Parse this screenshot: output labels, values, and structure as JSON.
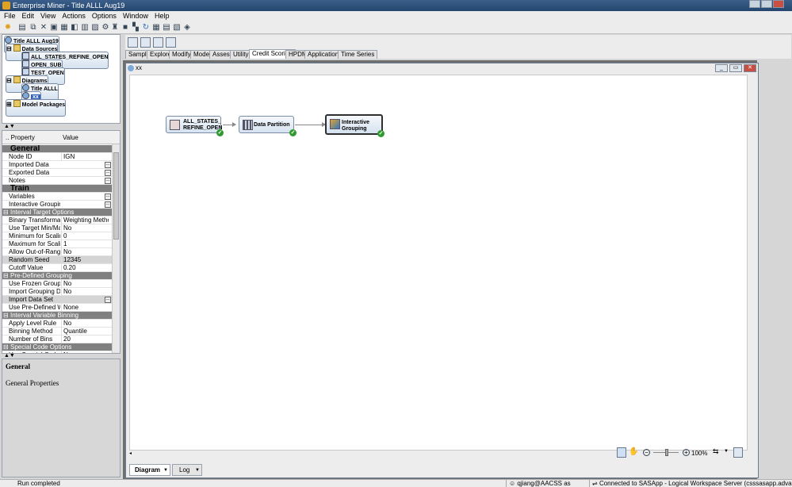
{
  "window": {
    "title": "Enterprise Miner - Title ALLL Aug19"
  },
  "menu": [
    "File",
    "Edit",
    "View",
    "Actions",
    "Options",
    "Window",
    "Help"
  ],
  "project_tree": {
    "root": "Title ALLL Aug19",
    "data_sources_label": "Data Sources",
    "data_sources": [
      "ALL_STATES_REFINE_OPEN",
      "OPEN_SUB",
      "TEST_OPEN"
    ],
    "diagrams_label": "Diagrams",
    "diagrams": [
      "Title ALLL",
      "xx"
    ],
    "model_packages_label": "Model Packages"
  },
  "properties": {
    "header_property": ".. Property",
    "header_value": "Value",
    "rows": [
      {
        "kind": "section",
        "label": "General"
      },
      {
        "kind": "row",
        "label": "Node ID",
        "value": "IGN"
      },
      {
        "kind": "row",
        "label": "Imported Data",
        "value": "",
        "ellipsis": true
      },
      {
        "kind": "row",
        "label": "Exported Data",
        "value": "",
        "ellipsis": true
      },
      {
        "kind": "row",
        "label": "Notes",
        "value": "",
        "ellipsis": true
      },
      {
        "kind": "section",
        "label": "Train"
      },
      {
        "kind": "row",
        "label": "Variables",
        "value": "",
        "ellipsis": true
      },
      {
        "kind": "row",
        "label": "Interactive Grouping",
        "value": "",
        "ellipsis": true
      },
      {
        "kind": "group",
        "label": "Interval Target Options"
      },
      {
        "kind": "row",
        "label": "Binary Transformation",
        "value": "Weighting Method"
      },
      {
        "kind": "row",
        "label": "Use Target Min/Max for Scaling",
        "value": "No"
      },
      {
        "kind": "row",
        "label": "Minimum for Scaling",
        "value": "0"
      },
      {
        "kind": "row",
        "label": "Maximum for Scaling",
        "value": "1"
      },
      {
        "kind": "row",
        "label": "Allow Out-of-Range Values",
        "value": "No"
      },
      {
        "kind": "row",
        "label": "Random Seed",
        "value": "12345",
        "gray": true
      },
      {
        "kind": "row",
        "label": "Cutoff Value",
        "value": "0.20"
      },
      {
        "kind": "group",
        "label": "Pre-Defined Grouping"
      },
      {
        "kind": "row",
        "label": "Use Frozen Groupings",
        "value": "No"
      },
      {
        "kind": "row",
        "label": "Import Grouping Data",
        "value": "No"
      },
      {
        "kind": "row",
        "label": "Import Data Set",
        "value": "",
        "ellipsis": true,
        "gray": true
      },
      {
        "kind": "row",
        "label": "Use Pre-Defined WOE",
        "value": "None"
      },
      {
        "kind": "group",
        "label": "Interval Variable Binning"
      },
      {
        "kind": "row",
        "label": "Apply Level Rule",
        "value": "No"
      },
      {
        "kind": "row",
        "label": "Binning Method",
        "value": "Quantile"
      },
      {
        "kind": "row",
        "label": "Number of Bins",
        "value": "20"
      },
      {
        "kind": "group",
        "label": "Special Code Options"
      },
      {
        "kind": "row",
        "label": "Use Special Codes",
        "value": "No"
      }
    ]
  },
  "description": {
    "title": "General",
    "text": "General Properties"
  },
  "node_tabs": [
    "Sample",
    "Explore",
    "Modify",
    "Model",
    "Assess",
    "Utility",
    "Credit Scoring",
    "HPDM",
    "Applications",
    "Time Series"
  ],
  "active_node_tab": "Credit Scoring",
  "diagram_window": {
    "title": "xx",
    "nodes": [
      {
        "line1": "ALL_STATES_",
        "line2": "REFINE_OPEN"
      },
      {
        "line1": "Data Partition",
        "line2": ""
      },
      {
        "line1": "Interactive",
        "line2": "Grouping"
      }
    ],
    "zoom": "100%",
    "bottom_tabs": [
      "Diagram",
      "Log"
    ]
  },
  "status_bar": {
    "left": "Run completed",
    "user": "qjiang@AACSS as Qiong Jiang",
    "server": "Connected to SASApp - Logical Workspace Server (csssasapp.advanceamerica.net)"
  }
}
